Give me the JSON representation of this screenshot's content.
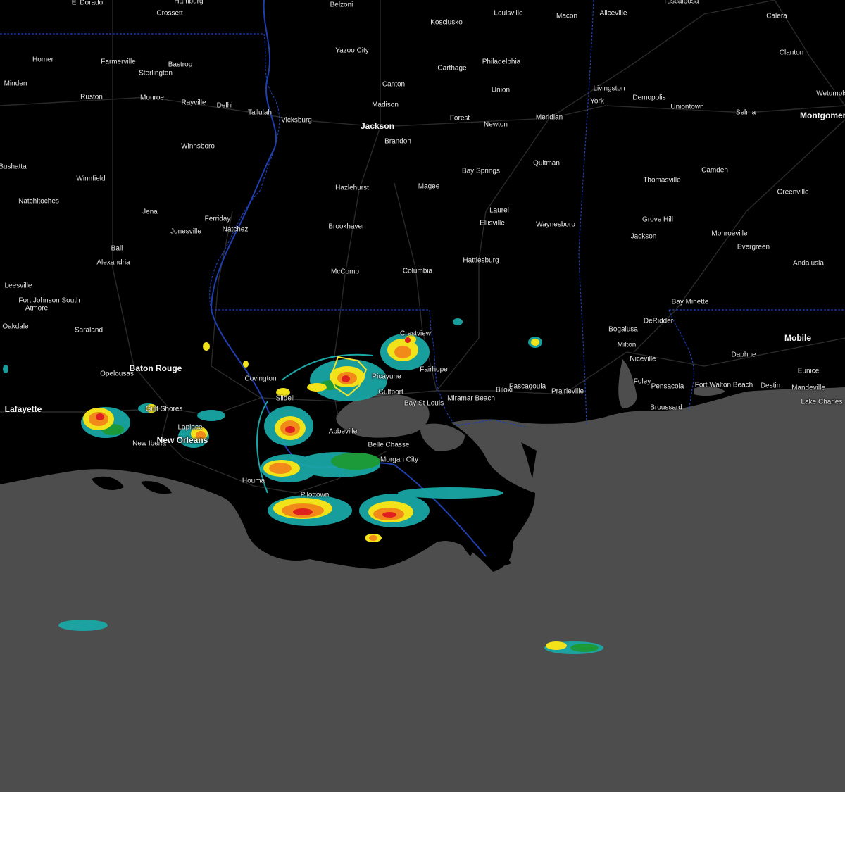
{
  "map": {
    "colors": {
      "land": "#000000",
      "water": "#4d4d4d",
      "roads": "#2a2a2a",
      "state_border": "#1f3fb0",
      "radar_light": "#1aa6a6",
      "radar_green": "#1c9a3a",
      "radar_yellow": "#f2e21a",
      "radar_orange": "#f28a1a",
      "radar_red": "#e02020",
      "warning_polygon": "#f5e52a"
    },
    "cities": [
      {
        "name": "El Dorado",
        "major": false
      },
      {
        "name": "Hamburg",
        "major": false
      },
      {
        "name": "Crossett",
        "major": false
      },
      {
        "name": "Belzoni",
        "major": false
      },
      {
        "name": "Kosciusko",
        "major": false
      },
      {
        "name": "Louisville",
        "major": false
      },
      {
        "name": "Macon",
        "major": false
      },
      {
        "name": "Aliceville",
        "major": false
      },
      {
        "name": "Tuscaloosa",
        "major": false
      },
      {
        "name": "Calera",
        "major": false
      },
      {
        "name": "Homer",
        "major": false
      },
      {
        "name": "Farmerville",
        "major": false
      },
      {
        "name": "Bastrop",
        "major": false
      },
      {
        "name": "Sterlington",
        "major": false
      },
      {
        "name": "Yazoo City",
        "major": false
      },
      {
        "name": "Philadelphia",
        "major": false
      },
      {
        "name": "Carthage",
        "major": false
      },
      {
        "name": "Clanton",
        "major": false
      },
      {
        "name": "Minden",
        "major": false
      },
      {
        "name": "Ruston",
        "major": false
      },
      {
        "name": "Monroe",
        "major": false
      },
      {
        "name": "Rayville",
        "major": false
      },
      {
        "name": "Delhi",
        "major": false
      },
      {
        "name": "Tallulah",
        "major": false
      },
      {
        "name": "Canton",
        "major": false
      },
      {
        "name": "Union",
        "major": false
      },
      {
        "name": "Livingston",
        "major": false
      },
      {
        "name": "Wetumpka",
        "major": false
      },
      {
        "name": "Madison",
        "major": false
      },
      {
        "name": "York",
        "major": false
      },
      {
        "name": "Demopolis",
        "major": false
      },
      {
        "name": "Uniontown",
        "major": false
      },
      {
        "name": "Selma",
        "major": false
      },
      {
        "name": "Montgomery",
        "major": true
      },
      {
        "name": "Vicksburg",
        "major": false
      },
      {
        "name": "Jackson",
        "major": true
      },
      {
        "name": "Forest",
        "major": false
      },
      {
        "name": "Newton",
        "major": false
      },
      {
        "name": "Meridian",
        "major": false
      },
      {
        "name": "Brandon",
        "major": false
      },
      {
        "name": "Winnsboro",
        "major": false
      },
      {
        "name": "Quitman",
        "major": false
      },
      {
        "name": "Bay Springs",
        "major": false
      },
      {
        "name": "Camden",
        "major": false
      },
      {
        "name": "Bushatta",
        "major": false
      },
      {
        "name": "Winnfield",
        "major": false
      },
      {
        "name": "Hazlehurst",
        "major": false
      },
      {
        "name": "Magee",
        "major": false
      },
      {
        "name": "Thomasville",
        "major": false
      },
      {
        "name": "Greenville",
        "major": false
      },
      {
        "name": "Natchitoches",
        "major": false
      },
      {
        "name": "Jena",
        "major": false
      },
      {
        "name": "Ferriday",
        "major": false
      },
      {
        "name": "Laurel",
        "major": false
      },
      {
        "name": "Grove Hill",
        "major": false
      },
      {
        "name": "Jonesville",
        "major": false
      },
      {
        "name": "Natchez",
        "major": false
      },
      {
        "name": "Brookhaven",
        "major": false
      },
      {
        "name": "Ellisville",
        "major": false
      },
      {
        "name": "Waynesboro",
        "major": false
      },
      {
        "name": "Monroeville",
        "major": false
      },
      {
        "name": "Jackson",
        "major": false
      },
      {
        "name": "Ball",
        "major": false
      },
      {
        "name": "Evergreen",
        "major": false
      },
      {
        "name": "Alexandria",
        "major": false
      },
      {
        "name": "Hattiesburg",
        "major": false
      },
      {
        "name": "Andalusia",
        "major": false
      },
      {
        "name": "McComb",
        "major": false
      },
      {
        "name": "Columbia",
        "major": false
      },
      {
        "name": "Leesville",
        "major": false
      },
      {
        "name": "Fort Johnson South",
        "major": false
      },
      {
        "name": "Atmore",
        "major": false
      },
      {
        "name": "Bay Minette",
        "major": false
      },
      {
        "name": "DeRidder",
        "major": false
      },
      {
        "name": "Oakdale",
        "major": false
      },
      {
        "name": "Saraland",
        "major": false
      },
      {
        "name": "Bogalusa",
        "major": false
      },
      {
        "name": "Crestview",
        "major": false
      },
      {
        "name": "Mobile",
        "major": true
      },
      {
        "name": "Milton",
        "major": false
      },
      {
        "name": "Daphne",
        "major": false
      },
      {
        "name": "Niceville",
        "major": false
      },
      {
        "name": "Eunice",
        "major": false
      },
      {
        "name": "Opelousas",
        "major": false
      },
      {
        "name": "Baton Rouge",
        "major": true
      },
      {
        "name": "Covington",
        "major": false
      },
      {
        "name": "Picayune",
        "major": false
      },
      {
        "name": "Fairhope",
        "major": false
      },
      {
        "name": "Foley",
        "major": false
      },
      {
        "name": "Pensacola",
        "major": false
      },
      {
        "name": "Fort Walton Beach",
        "major": false
      },
      {
        "name": "Destin",
        "major": false
      },
      {
        "name": "Mandeville",
        "major": false
      },
      {
        "name": "Gulfport",
        "major": false
      },
      {
        "name": "Biloxi",
        "major": false
      },
      {
        "name": "Pascagoula",
        "major": false
      },
      {
        "name": "Prairieville",
        "major": false
      },
      {
        "name": "Slidell",
        "major": false
      },
      {
        "name": "Bay St Louis",
        "major": false
      },
      {
        "name": "Miramar Beach",
        "major": false
      },
      {
        "name": "Lake Charles",
        "major": false
      },
      {
        "name": "Lafayette",
        "major": true
      },
      {
        "name": "Gulf Shores",
        "major": false
      },
      {
        "name": "Broussard",
        "major": false
      },
      {
        "name": "Laplace",
        "major": false
      },
      {
        "name": "Abbeville",
        "major": false
      },
      {
        "name": "New Iberia",
        "major": false
      },
      {
        "name": "New Orleans",
        "major": true
      },
      {
        "name": "Belle Chasse",
        "major": false
      },
      {
        "name": "Morgan City",
        "major": false
      },
      {
        "name": "Houma",
        "major": false
      },
      {
        "name": "Pilottown",
        "major": false
      }
    ]
  }
}
